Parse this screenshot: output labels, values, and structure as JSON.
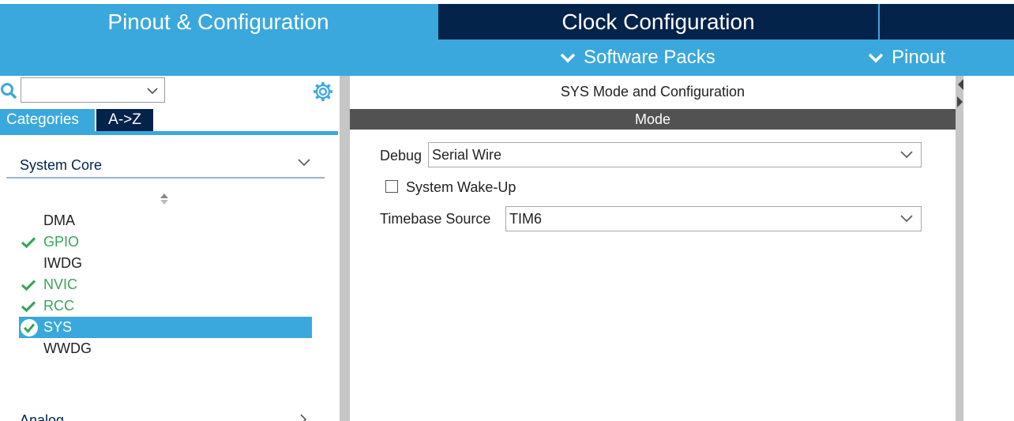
{
  "top_tabs": {
    "pinout_configuration": "Pinout & Configuration",
    "clock_configuration": "Clock Configuration"
  },
  "toolbar": {
    "software_packs": "Software Packs",
    "pinout": "Pinout"
  },
  "sidebar": {
    "search": {
      "value": ""
    },
    "tabs": {
      "categories": "Categories",
      "az": "A->Z"
    },
    "group": "System Core",
    "items": [
      {
        "label": "DMA",
        "configured": false,
        "selected": false
      },
      {
        "label": "GPIO",
        "configured": true,
        "selected": false
      },
      {
        "label": "IWDG",
        "configured": false,
        "selected": false
      },
      {
        "label": "NVIC",
        "configured": true,
        "selected": false
      },
      {
        "label": "RCC",
        "configured": true,
        "selected": false
      },
      {
        "label": "SYS",
        "configured": true,
        "selected": true
      },
      {
        "label": "WWDG",
        "configured": false,
        "selected": false
      }
    ],
    "next_group": "Analog"
  },
  "main": {
    "title": "SYS Mode and Configuration",
    "section": "Mode",
    "debug": {
      "label": "Debug",
      "value": "Serial Wire"
    },
    "wakeup": {
      "label": "System Wake-Up",
      "checked": false
    },
    "timebase": {
      "label": "Timebase Source",
      "value": "TIM6"
    }
  },
  "colors": {
    "accent": "#3aa8dc",
    "navy": "#03234b",
    "configured_green": "#3aa45a",
    "mode_bar": "#525252"
  }
}
